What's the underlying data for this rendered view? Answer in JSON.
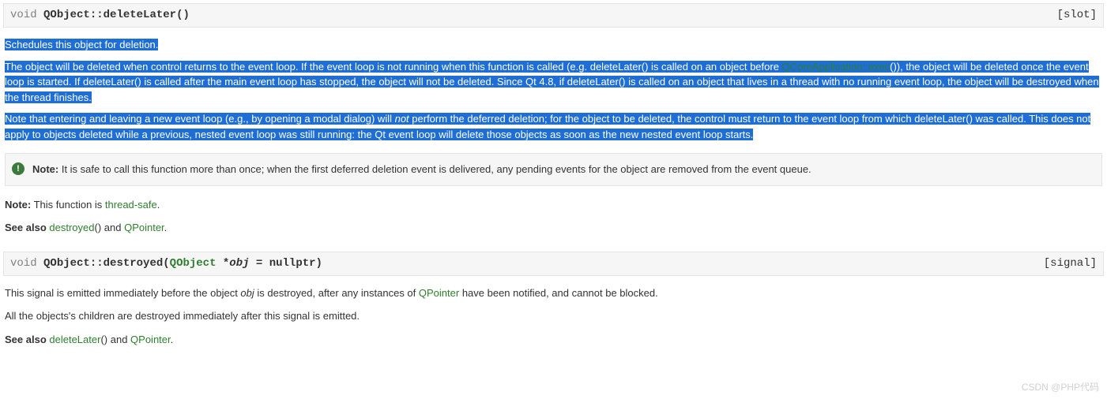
{
  "fn1": {
    "kw": "void",
    "cls": "QObject::",
    "name": "deleteLater",
    "params": "()",
    "tag": "[slot]"
  },
  "p1": "Schedules this object for deletion.",
  "p2a": "The object will be deleted when control returns to the event loop. If the event loop is not running when this function is called (e.g. deleteLater() is called on an object before ",
  "p2link": "QCoreApplication::exec",
  "p2b": "()), the object will be deleted once the event loop is started. If deleteLater() is called after the main event loop has stopped, the object will not be deleted. Since Qt 4.8, if deleteLater() is called on an object that lives in a thread with no running event loop, the object will be destroyed when the thread finishes.",
  "p3a": "Note that entering and leaving a new event loop (e.g., by opening a modal dialog) will ",
  "p3em": "not",
  "p3b": " perform the deferred deletion; for the object to be deleted, the control must return to the event loop from which deleteLater() was called. This does not apply to objects deleted while a previous, nested event loop was still running: the Qt event loop will delete those objects as soon as the new nested event loop starts.",
  "note": {
    "label": "Note:",
    "text": " It is safe to call this function more than once; when the first deferred deletion event is delivered, any pending events for the object are removed from the event queue."
  },
  "p4": {
    "label": "Note:",
    "mid": " This function is ",
    "link": "thread-safe",
    "end": "."
  },
  "p5": {
    "label": "See also",
    "a1": "destroyed",
    "paren1": "()",
    "and": " and ",
    "a2": "QPointer",
    "end": "."
  },
  "fn2": {
    "kw": "void",
    "cls": "QObject::",
    "name": "destroyed",
    "open": "(",
    "type": "QObject",
    "star": " *",
    "param": "obj",
    "def": " = nullptr)",
    "tag": "[signal]"
  },
  "p6a": "This signal is emitted immediately before the object ",
  "p6em": "obj",
  "p6b": " is destroyed, after any instances of ",
  "p6link": "QPointer",
  "p6c": " have been notified, and cannot be blocked.",
  "p7": "All the objects's children are destroyed immediately after this signal is emitted.",
  "p8": {
    "label": "See also",
    "a1": "deleteLater",
    "paren1": "()",
    "and": " and ",
    "a2": "QPointer",
    "end": "."
  },
  "watermark": "CSDN @PHP代码"
}
